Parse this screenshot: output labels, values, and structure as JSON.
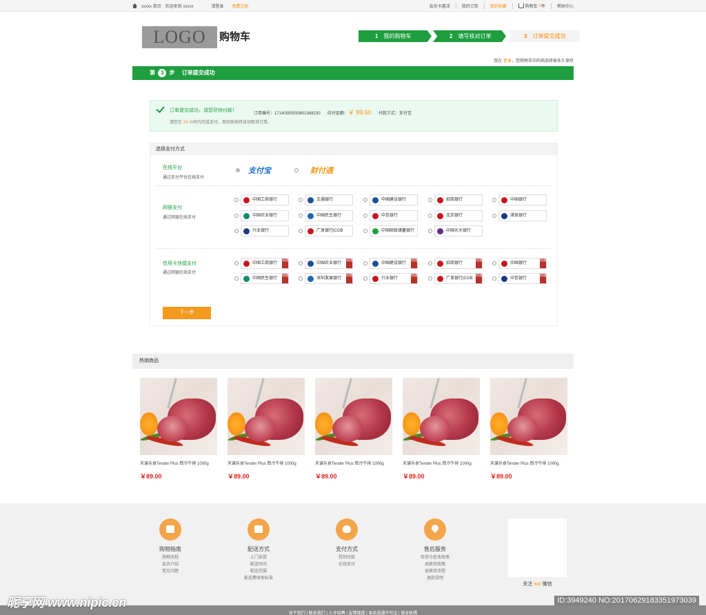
{
  "topbar": {
    "site": "xxxxx 首页",
    "welcome": "欢迎来到 xxxxx",
    "login": "请登录",
    "register": "免费注册",
    "member": "会员卡邀活",
    "my_orders": "我的订单",
    "my_collect": "我的收藏",
    "cart": "购物车",
    "cart_count": "0",
    "cart_unit": "件",
    "help": "帮助中心"
  },
  "header": {
    "logo": "LOGO",
    "title": "购物车",
    "steps": [
      {
        "num": "1",
        "label": "我的购物车"
      },
      {
        "num": "2",
        "label": "填写核对订单"
      },
      {
        "num": "3",
        "label": "订单提交成功"
      }
    ],
    "notice_prefix": "我在",
    "notice_link": "登录",
    "notice_suffix": "，您购物车中的商品将被永久保存"
  },
  "stepbar": {
    "prefix": "第",
    "num": "3",
    "suffix": "步",
    "label": "订单提交成功"
  },
  "success": {
    "message": "订单提交成功，请您尽快付款！",
    "order_label": "订单编号：",
    "order_no": "17140505033602368230",
    "amount_label": "应付金额：",
    "amount": "￥ 99.60",
    "pay_label": "付款方式：",
    "pay_method": "支付宝",
    "sub_prefix": "请您在",
    "sub_hours": "24",
    "sub_suffix": "小时内完成支付，否则系统将自动取消订单。"
  },
  "payment": {
    "header": "选择支付方式",
    "online": {
      "name": "在线平台",
      "desc": "通过支付平台在线支付",
      "platforms": [
        "支付宝",
        "财付通"
      ]
    },
    "netbank": {
      "name": "网银支付",
      "desc": "通过网银在线支付",
      "banks": [
        "中国工商银行",
        "交通银行",
        "中国建设银行",
        "招商银行",
        "中国银行",
        "中国农业银行",
        "中国民生银行",
        "中信银行",
        "北京银行",
        "浦发银行",
        "兴业银行",
        "广发银行|CGB",
        "中国邮政储蓄银行",
        "中国光大银行"
      ]
    },
    "credit": {
      "name": "信用卡快捷支付",
      "desc": "通过网银在线支付",
      "banks": [
        "中国工商银行",
        "中国农业银行",
        "中国建设银行",
        "招商银行",
        "中国银行",
        "中国民生银行",
        "深圳发展银行",
        "兴业银行",
        "广发银行|CGB",
        "中信银行"
      ],
      "tag": "快捷"
    },
    "next_button": "下一步"
  },
  "hot": {
    "title": "热销商品",
    "products": [
      {
        "name": "天谱乐食Tender Plus 西冷牛排 1000g",
        "price": "￥89.00"
      },
      {
        "name": "天谱乐食Tender Plus 西冷牛排 1000g",
        "price": "￥89.00"
      },
      {
        "name": "天谱乐食Tender Plus 西冷牛排 1000g",
        "price": "￥89.00"
      },
      {
        "name": "天谱乐食Tender Plus 西冷牛排 1000g",
        "price": "￥89.00"
      },
      {
        "name": "天谱乐食Tender Plus 西冷牛排 1000g",
        "price": "￥89.00"
      }
    ]
  },
  "footer": {
    "cols": [
      {
        "title": "购物指南",
        "icon": "map-icon",
        "links": [
          "购物流程",
          "会员介绍",
          "常见问题"
        ]
      },
      {
        "title": "配送方式",
        "icon": "truck-icon",
        "links": [
          "上门自提",
          "配送时间",
          "配送范围",
          "配送费收取标准"
        ]
      },
      {
        "title": "支付方式",
        "icon": "money-bag-icon",
        "links": [
          "货到付款",
          "在线支付"
        ]
      },
      {
        "title": "售后服务",
        "icon": "heart-icon",
        "links": [
          "验货与拒收政策",
          "退换货政策",
          "退换货流程",
          "退款说明"
        ]
      }
    ],
    "qr_prefix": "关注",
    "qr_brand": "xxx",
    "qr_suffix": "微信",
    "links": "关于我们 | 联系我们 | 人才招聘 | 友情链接 | 食品流通许可证 | 营业执照"
  },
  "watermark": {
    "left": "昵享网 www.nipic.cn",
    "right": "ID:3949240 NO:20170629183351973039"
  },
  "colors": {
    "brand_green": "#1e9e3f",
    "accent_orange": "#ff8a00",
    "price_red": "#e0201a"
  }
}
